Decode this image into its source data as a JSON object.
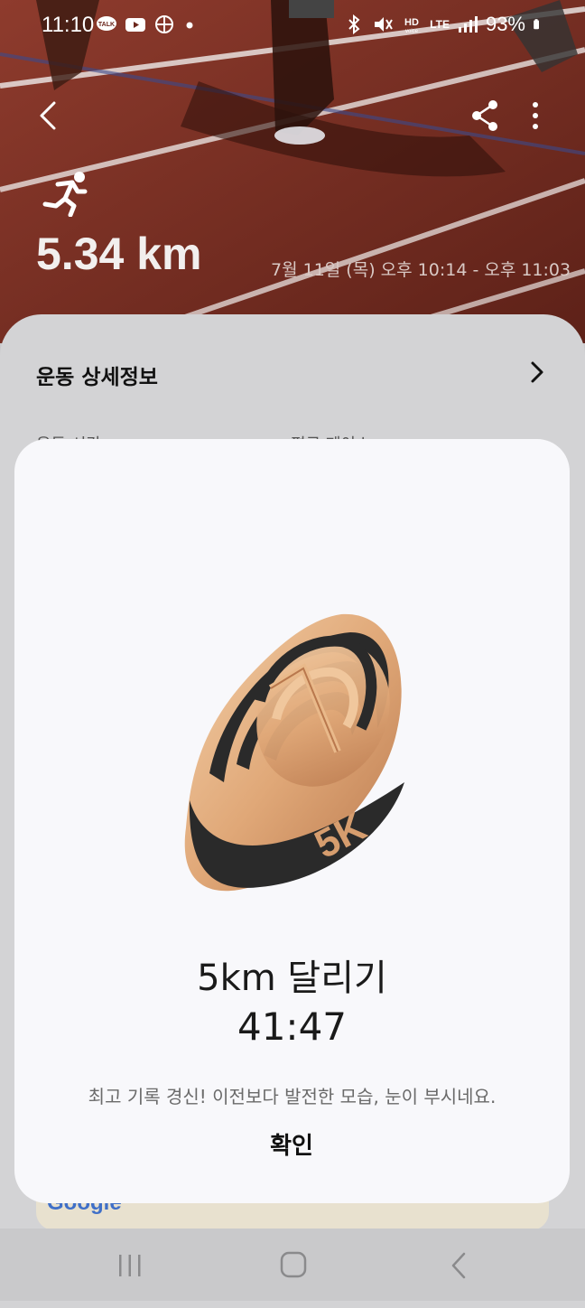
{
  "status_bar": {
    "time": "11:10",
    "network": "LTE",
    "battery": "93%",
    "icons": [
      "kakaotalk-icon",
      "youtube-icon",
      "pinwheel-icon",
      "bluetooth-icon",
      "mute-icon",
      "hd-voice-icon",
      "lte-icon",
      "signal-icon",
      "battery-icon"
    ]
  },
  "workout": {
    "distance": "5.34 km",
    "date_range": "7월 11일 (목) 오후 10:14 - 오후 11:03"
  },
  "details_card": {
    "title": "운동 상세정보",
    "partial_left": "운동 시간",
    "partial_right": "평균 페이스",
    "map_brand": "Google"
  },
  "achievement_dialog": {
    "badge_label": "5K",
    "title": "5km 달리기",
    "time": "41:47",
    "message": "최고 기록 경신! 이전보다 발전한 모습, 눈이 부시네요.",
    "confirm_label": "확인"
  },
  "colors": {
    "track_red": "#7a2e22",
    "dialog_bg": "#f8f8fb",
    "badge_gold": "#e0a878",
    "badge_dark": "#2a2a2a"
  }
}
